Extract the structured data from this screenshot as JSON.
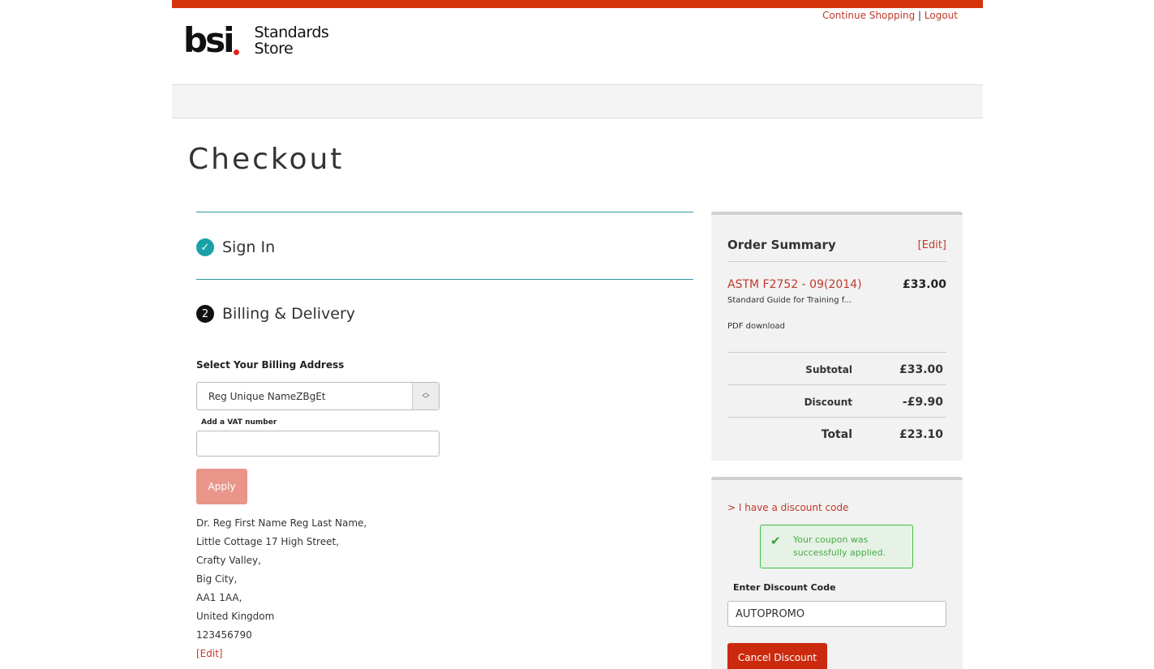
{
  "header": {
    "logo_text": "bsi",
    "logo_store_line1": "Standards",
    "logo_store_line2": "Store",
    "continue_shopping": "Continue Shopping",
    "separator": "|",
    "logout": "Logout"
  },
  "page_title": "Checkout",
  "steps": {
    "sign_in": {
      "label": "Sign In",
      "icon": "check-icon"
    },
    "billing": {
      "label": "Billing & Delivery",
      "number": "2"
    }
  },
  "billing": {
    "select_label": "Select Your Billing Address",
    "selected_address": "Reg Unique NameZBgEt",
    "vat_label": "Add a VAT number",
    "vat_value": "",
    "apply_label": "Apply",
    "address_lines": [
      "Dr. Reg First Name Reg Last Name,",
      "Little Cottage 17 High Street,",
      "Crafty Valley,",
      "Big City,",
      "AA1 1AA,",
      "United Kingdom",
      "123456790"
    ],
    "edit_label": "[Edit]"
  },
  "order_summary": {
    "title": "Order Summary",
    "edit_label": "[Edit]",
    "product": {
      "name": "ASTM F2752 - 09(2014)",
      "price": "£33.00",
      "description": "Standard Guide for Training f...",
      "format": "PDF download"
    },
    "subtotal_label": "Subtotal",
    "subtotal_value": "£33.00",
    "discount_label": "Discount",
    "discount_value": "-£9.90",
    "total_label": "Total",
    "total_value": "£23.10"
  },
  "discount": {
    "toggle_label": "> I have a discount code",
    "success_message": "Your coupon was successfully applied.",
    "code_label": "Enter Discount Code",
    "code_value": "AUTOPROMO",
    "cancel_label": "Cancel Discount"
  },
  "colors": {
    "brand_red": "#d6330c",
    "link_red": "#c0392b",
    "teal": "#1aa1a8",
    "success_green": "#3fbf3f",
    "apply_disabled": "#e9958a"
  }
}
